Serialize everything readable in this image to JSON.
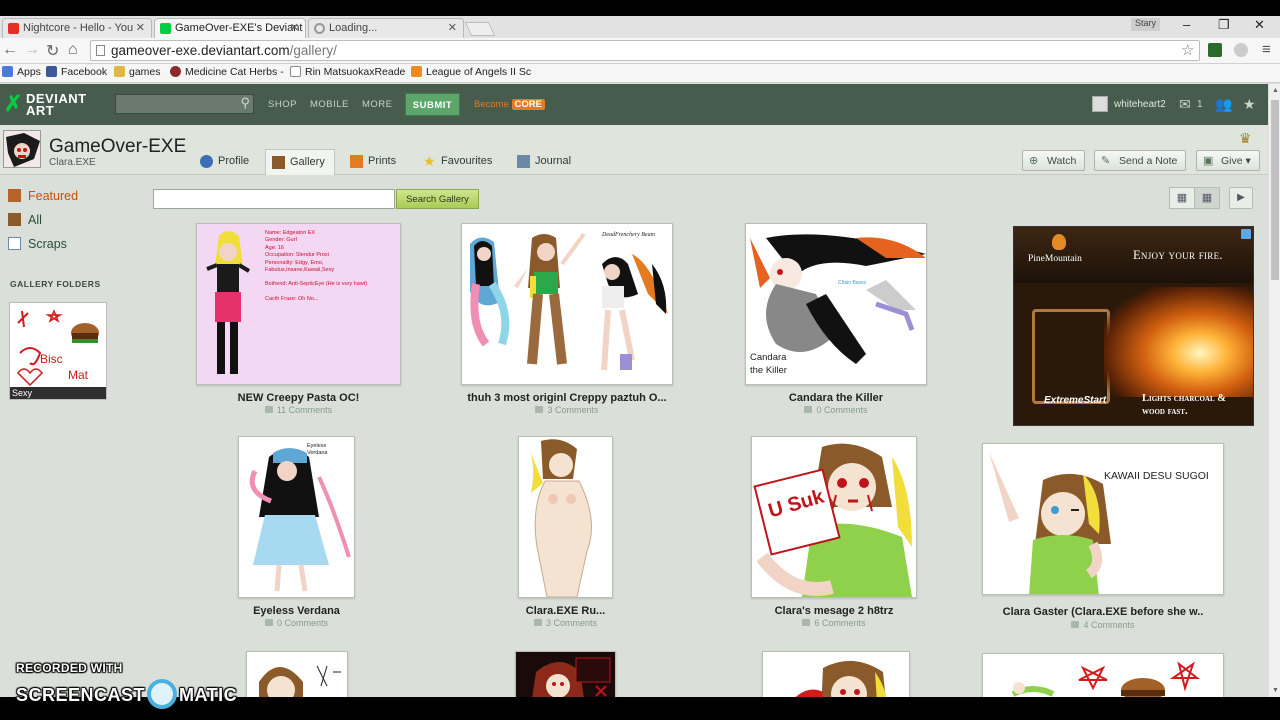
{
  "browser": {
    "tabs": [
      {
        "label": "Nightcore - Hello - You",
        "favicon_color": "#e52d27"
      },
      {
        "label": "GameOver-EXE's Deviant",
        "favicon_color": "#05cc47"
      },
      {
        "label": "Loading...",
        "favicon_color": "#999999"
      }
    ],
    "window_user": "Stary",
    "url_host": "gameover-exe.deviantart.com",
    "url_path": "/gallery/",
    "bookmarks": [
      {
        "label": "Apps",
        "icon": "apps-grid-icon",
        "color": "#4a7bd6"
      },
      {
        "label": "Facebook",
        "icon": "facebook-icon",
        "color": "#3b5998"
      },
      {
        "label": "games",
        "icon": "folder-icon",
        "color": "#e0b84a"
      },
      {
        "label": "Medicine Cat Herbs -",
        "icon": "cat-icon",
        "color": "#8b2a2a"
      },
      {
        "label": "Rin MatsuokaxReade",
        "icon": "page-icon",
        "color": "#ffffff"
      },
      {
        "label": "League of Angels II Sc",
        "icon": "loa-icon",
        "color": "#f08a1d"
      }
    ]
  },
  "da_header": {
    "logo_line1": "DEVIANT",
    "logo_line2": "ART",
    "nav": [
      "SHOP",
      "MOBILE",
      "MORE"
    ],
    "submit_label": "SUBMIT",
    "become_label": "Become",
    "core_label": "CORE",
    "username": "whiteheart2",
    "notes_count": "1"
  },
  "profile": {
    "name": "GameOver-EXE",
    "subtitle": "Clara.EXE",
    "tabs": [
      "Profile",
      "Gallery",
      "Prints",
      "Favourites",
      "Journal"
    ],
    "active_tab": "Gallery",
    "buttons": [
      "Watch",
      "Send a Note",
      "Give"
    ]
  },
  "sidebar": {
    "items": [
      "Featured",
      "All",
      "Scraps"
    ],
    "folders_title": "GALLERY FOLDERS",
    "folder_name": "Sexy"
  },
  "gallery": {
    "search_placeholder": "",
    "search_button": "Search Gallery",
    "items": [
      {
        "title": "NEW Creepy Pasta OC!",
        "comments": "11 Comments"
      },
      {
        "title": "thuh 3 most originl Creppy paztuh O...",
        "comments": "3 Comments"
      },
      {
        "title": "Candara the Killer",
        "comments": "0 Comments"
      },
      {
        "title": "Eyeless Verdana",
        "comments": "0 Comments"
      },
      {
        "title": "Clara.EXE Ru...",
        "comments": "3 Comments"
      },
      {
        "title": "Clara's mesage 2 h8trz",
        "comments": "6 Comments"
      },
      {
        "title": "Clara Gaster (Clara.EXE before she w..",
        "comments": "4 Comments"
      }
    ],
    "oc_text": [
      "Name: Edgeaton EX",
      "Gender: Gurl",
      "Age: 16",
      "Occupation: Slendur Proxi",
      "Personality: Edgy, Emo,",
      "Fabulus,Insane,Kawaii,Sexy",
      "Boifrend: Anti-SepticEye (He iz vury hawt)",
      "Cacth Fraze: Oh No..."
    ],
    "candara_caption": [
      "Candara",
      "the Killer"
    ],
    "eyeless_caption": [
      "Eyeless",
      "Verdana"
    ],
    "kawaii_text": "KAWAII DESU SUGOI",
    "usuk_text": "U Suk"
  },
  "ad": {
    "brand": "PineMountain",
    "headline": "Enjoy your fire.",
    "sub_brand": "ExtremeStart",
    "tagline_line1": "Lights charcoal &",
    "tagline_line2": "wood fast."
  },
  "watermark": {
    "line1": "RECORDED WITH",
    "line2a": "SCREENCAST",
    "line2b": "MATIC"
  }
}
